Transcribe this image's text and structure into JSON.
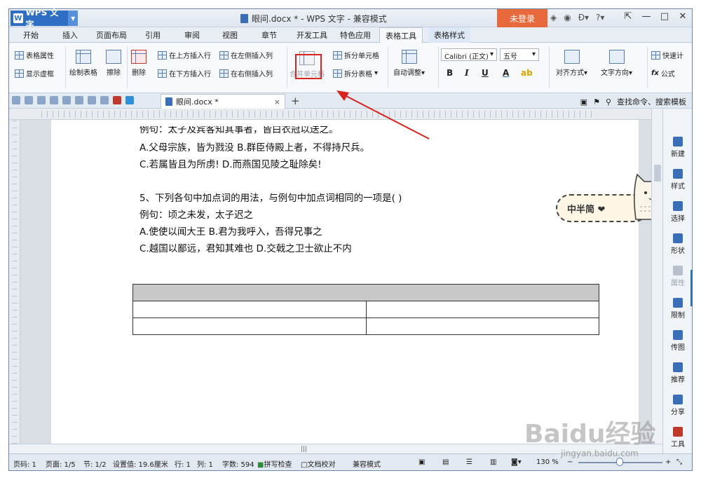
{
  "window": {
    "app_name": "WPS 文字",
    "title": "眼间.docx * - WPS 文字 - 兼容模式",
    "login": "未登录"
  },
  "menu": {
    "tabs": [
      "开始",
      "插入",
      "页面布局",
      "引用",
      "审阅",
      "视图",
      "章节",
      "开发工具",
      "特色应用",
      "表格工具",
      "表格样式"
    ],
    "active": "表格工具"
  },
  "ribbon": {
    "table_props": "表格属性",
    "show_grid": "显示虚框",
    "draw_table": "绘制表格",
    "eraser": "擦除",
    "delete": "删除",
    "insert_above": "在上方插入行",
    "insert_below": "在下方插入行",
    "insert_left": "在左侧插入列",
    "insert_right": "在右侧插入列",
    "merge_cells": "合并单元格",
    "split_cells": "拆分单元格",
    "split_table": "拆分表格",
    "auto_adjust": "自动调整",
    "font_name": "Calibri (正文)",
    "font_size": "五号",
    "bold": "B",
    "italic": "I",
    "underline": "U",
    "font_color": "A",
    "align": "对齐方式",
    "text_dir": "文字方向",
    "formula": "公式",
    "quick_calc": "快速计"
  },
  "doc_tab": {
    "name": "眼间.docx *",
    "close": "×",
    "add": "+",
    "search": "查找命令、搜索模板"
  },
  "document": {
    "lines": [
      "例句：太子及宾客知其事者，皆白衣冠以送之。",
      "A.父母宗族，皆为戮没  B.群臣侍殿上者，不得持尺兵。",
      "C.若属皆且为所虏! D.而燕国见陵之耻除矣!",
      "5、下列各句中加点词的用法，与例句中加点词相同的一项是( )",
      "例句：顷之未发，太子迟之",
      "A.使使以闻大王 B.君为我呼入，吾得兄事之",
      "C.越国以鄙远，君知其难也 D.交戟之卫士欲止不内"
    ],
    "sticker": "中半简 ❤"
  },
  "right_panel": [
    "新建",
    "样式",
    "选择",
    "形状",
    "属性",
    "限制",
    "传图",
    "推荐",
    "分享",
    "工具"
  ],
  "status": {
    "page_no": "页码: 1",
    "pages": "页面: 1/5",
    "section": "节: 1/2",
    "setting": "设置值: 19.6厘米",
    "row": "行: 1",
    "col": "列: 1",
    "words": "字数: 594",
    "spell": "拼写检查",
    "doc_check": "文档校对",
    "compat": "兼容模式",
    "zoom": "130 %"
  },
  "watermark": {
    "brand": "Baidu经验",
    "url": "jingyan.baidu.com"
  },
  "colors": {
    "accent": "#2f6fc3",
    "login": "#e86a3c",
    "annotation": "#d8231f"
  }
}
